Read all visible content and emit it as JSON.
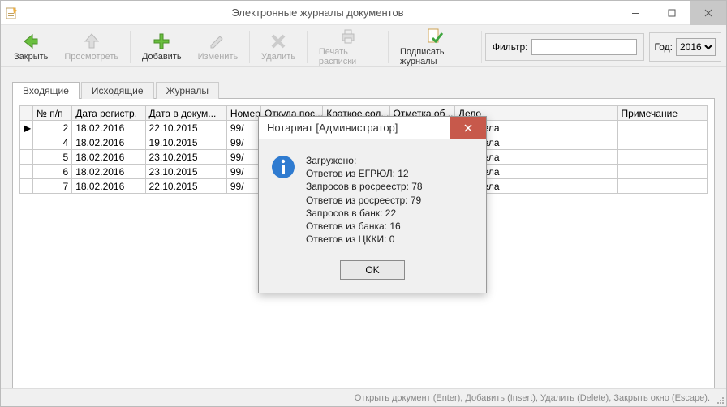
{
  "window": {
    "title": "Электронные журналы документов"
  },
  "toolbar": {
    "close": "Закрыть",
    "view": "Просмотреть",
    "add": "Добавить",
    "edit": "Изменить",
    "delete": "Удалить",
    "print": "Печать расписки",
    "sign": "Подписать журналы",
    "filter_label": "Фильтр:",
    "filter_value": "",
    "year_label": "Год:",
    "year_value": "2016"
  },
  "tabs": [
    {
      "label": "Входящие",
      "active": true
    },
    {
      "label": "Исходящие",
      "active": false
    },
    {
      "label": "Журналы",
      "active": false
    }
  ],
  "grid": {
    "columns": [
      "",
      "№ п/п",
      "Дата регистр.",
      "Дата в докум...",
      "Номер",
      "Откуда пос...",
      "Краткое сод...",
      "Отметка об ...",
      "Дело",
      "Примечание"
    ],
    "rows": [
      {
        "marker": "▶",
        "num": "2",
        "regdate": "18.02.2016",
        "docdate": "22.10.2015",
        "number": "99/",
        "from": "",
        "summary": "",
        "note": "",
        "case": "Нет дела",
        "remark": ""
      },
      {
        "marker": "",
        "num": "4",
        "regdate": "18.02.2016",
        "docdate": "19.10.2015",
        "number": "99/",
        "from": "",
        "summary": "",
        "note": "",
        "case": "Нет дела",
        "remark": ""
      },
      {
        "marker": "",
        "num": "5",
        "regdate": "18.02.2016",
        "docdate": "23.10.2015",
        "number": "99/",
        "from": "",
        "summary": "",
        "note": "",
        "case": "Нет дела",
        "remark": ""
      },
      {
        "marker": "",
        "num": "6",
        "regdate": "18.02.2016",
        "docdate": "23.10.2015",
        "number": "99/",
        "from": "",
        "summary": "",
        "note": "",
        "case": "Нет дела",
        "remark": ""
      },
      {
        "marker": "",
        "num": "7",
        "regdate": "18.02.2016",
        "docdate": "22.10.2015",
        "number": "99/",
        "from": "",
        "summary": "",
        "note": "",
        "case": "Нет дела",
        "remark": ""
      }
    ]
  },
  "statusbar": "Открыть документ (Enter), Добавить (Insert), Удалить (Delete), Закрыть окно (Escape).",
  "dialog": {
    "title": "Нотариат [Администратор]",
    "lines": [
      "Загружено:",
      "Ответов из ЕГРЮЛ: 12",
      "Запросов в росреестр: 78",
      "Ответов из росреестр: 79",
      "Запросов в банк: 22",
      "Ответов из банка: 16",
      "Ответов из ЦККИ: 0"
    ],
    "ok": "OK"
  }
}
